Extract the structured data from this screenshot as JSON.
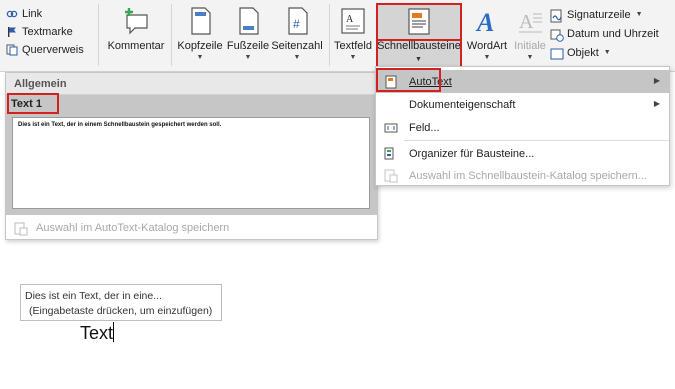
{
  "ribbon": {
    "links": [
      {
        "label": "Link",
        "icon": "link-icon"
      },
      {
        "label": "Textmarke",
        "icon": "bookmark-icon"
      },
      {
        "label": "Querverweis",
        "icon": "cross-reference-icon"
      }
    ],
    "comment_label": "Kommentar",
    "header_label": "Kopfzeile",
    "footer_label": "Fußzeile",
    "page_number_label": "Seitenzahl",
    "textbox_label": "Textfeld",
    "quick_parts_label": "Schnellbausteine",
    "wordart_label": "WordArt",
    "dropcap_label": "Initiale",
    "signature_label": "Signaturzeile",
    "datetime_label": "Datum und Uhrzeit",
    "object_label": "Objekt"
  },
  "gallery": {
    "header": "Allgemein",
    "entry_title": "Text 1",
    "entry_preview": "Dies ist ein Text, der in einem Schnellbaustein gespeichert werden soll.",
    "footer_label": "Auswahl im AutoText-Katalog speichern"
  },
  "menu": {
    "items": [
      {
        "label": "AutoText",
        "has_submenu": true
      },
      {
        "label": "Dokumenteigenschaft",
        "has_submenu": true
      },
      {
        "label": "Feld...",
        "has_submenu": false
      },
      {
        "label": "Organizer für Bausteine...",
        "has_submenu": false
      },
      {
        "label": "Auswahl im Schnellbaustein-Katalog speichern...",
        "has_submenu": false
      }
    ]
  },
  "document": {
    "autocomplete_line1": "Dies ist ein Text, der in eine...",
    "autocomplete_line2": "(Eingabetaste drücken, um einzufügen)",
    "typed_text": "Text"
  },
  "colors": {
    "highlight_border": "#d32020",
    "wordart_blue": "#2b6cc4",
    "comment_green": "#3aa655"
  }
}
